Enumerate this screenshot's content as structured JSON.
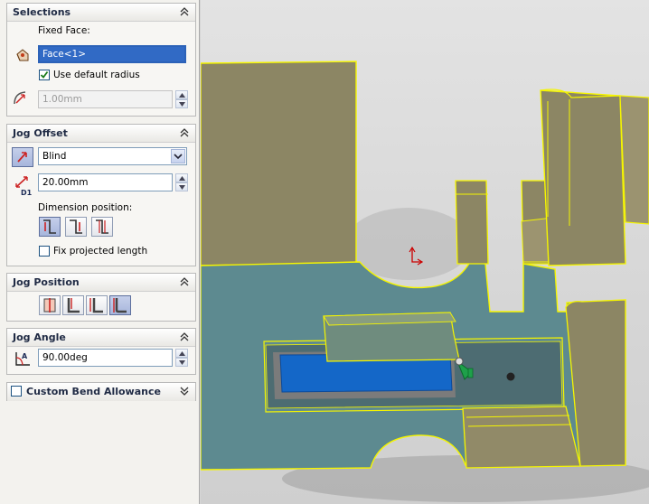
{
  "selections": {
    "title": "Selections",
    "fixed_face_label": "Fixed Face:",
    "fixed_face_value": "Face<1>",
    "use_default_radius_label": "Use default radius",
    "use_default_radius_checked": true,
    "radius_value": "1.00mm"
  },
  "jog_offset": {
    "title": "Jog Offset",
    "end_condition": "Blind",
    "distance_value": "20.00mm",
    "dimension_position_label": "Dimension position:",
    "fix_projected_length_label": "Fix projected length",
    "fix_projected_length_checked": false
  },
  "jog_position": {
    "title": "Jog Position"
  },
  "jog_angle": {
    "title": "Jog Angle",
    "angle_value": "90.00deg"
  },
  "custom_bend_allowance": {
    "title": "Custom Bend Allowance",
    "checked": false
  },
  "icons": {
    "fixed_face": "fixed-face-icon",
    "radius": "bend-radius-icon",
    "direction": "reverse-direction-icon",
    "offset_distance": "offset-distance-icon",
    "angle": "jog-angle-icon",
    "dimension_positions": [
      "outside-offset-icon",
      "inside-offset-icon",
      "overall-dimension-icon"
    ],
    "jog_positions": [
      "bend-centerline-icon",
      "material-inside-icon",
      "material-outside-icon",
      "bend-outside-icon"
    ],
    "axis_triad": "origin-triad-icon"
  },
  "colors": {
    "panel_bg": "#f3f2ee",
    "group_title": "#1f2a44",
    "selection_highlight": "#316ac5",
    "part_face": "#5b8a8f",
    "part_outline": "#f5f500",
    "selected_face": "#1467c8",
    "origin": "#cc0000"
  }
}
